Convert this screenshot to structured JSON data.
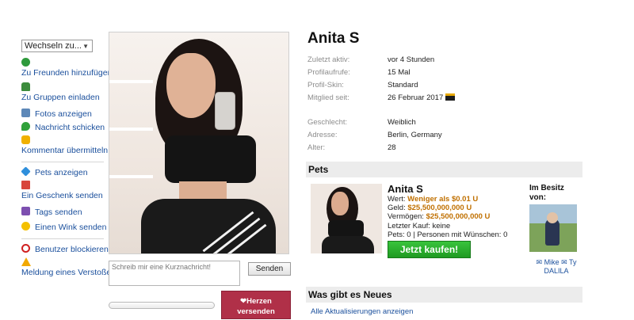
{
  "actions": {
    "switch_label": "Wechseln zu...",
    "items": [
      {
        "label": "Zu Freunden hinzufügen",
        "icon": "add-friend-icon"
      },
      {
        "label": "Zu Gruppen einladen",
        "icon": "group-icon"
      },
      {
        "label": "Fotos anzeigen",
        "icon": "camera-icon"
      },
      {
        "label": "Nachricht schicken",
        "icon": "message-icon"
      },
      {
        "label": "Kommentar übermitteln",
        "icon": "comment-icon"
      },
      {
        "label": "Pets anzeigen",
        "icon": "tag-icon"
      },
      {
        "label": "Ein Geschenk senden",
        "icon": "gift-icon"
      },
      {
        "label": "Tags senden",
        "icon": "star-icon"
      },
      {
        "label": "Einen Wink senden",
        "icon": "smile-icon"
      },
      {
        "label": "Benutzer blockieren",
        "icon": "block-icon"
      },
      {
        "label": "Meldung eines Verstoßes",
        "icon": "warning-icon"
      }
    ]
  },
  "status": {
    "placeholder": "Schreib mir eine Kurznachricht!",
    "send_label": "Senden",
    "hearts_label_1": "Herzen",
    "hearts_label_2": "versenden"
  },
  "profile": {
    "name": "Anita S",
    "fields": [
      {
        "label": "Zuletzt aktiv:",
        "value": "vor 4 Stunden"
      },
      {
        "label": "Profilaufrufe:",
        "value": "15 Mal"
      },
      {
        "label": "Profil-Skin:",
        "value": "Standard"
      },
      {
        "label": "Mitglied seit:",
        "value": "26 Februar 2017"
      },
      {
        "label": "Geschlecht:",
        "value": "Weiblich"
      },
      {
        "label": "Adresse:",
        "value": "Berlin, Germany"
      },
      {
        "label": "Alter:",
        "value": "28"
      }
    ]
  },
  "pets": {
    "section_title": "Pets",
    "name": "Anita S",
    "value_label": "Wert:",
    "value": "Weniger als $0.01 U",
    "cash_label": "Geld:",
    "cash": "$25,500,000,000 U",
    "assets_label": "Vermögen:",
    "assets": "$25,500,000,000 U",
    "last_purchase": "Letzter Kauf: keine",
    "counts": "Pets: 0 | Personen mit Wünschen: 0",
    "buy_label": "Jetzt kaufen!",
    "owner_title": "Im Besitz von:",
    "owner_name": "✉ Mike ✉ Ty DALILA"
  },
  "news": {
    "section_title": "Was gibt es Neues",
    "link_label": "Alle Aktualisierungen anzeigen"
  },
  "colors": {
    "link": "#1a4f9c",
    "money": "#c07000",
    "buy_button": "#1f9a22",
    "hearts_button": "#b03048"
  }
}
